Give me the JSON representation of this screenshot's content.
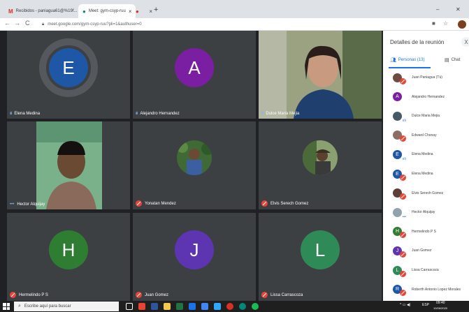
{
  "browser": {
    "tabs": [
      {
        "icon": "M",
        "title": "Recibidos - paniagua61@%19f..."
      },
      {
        "icon": "●",
        "title": "Meet: gym-csyp-ruu"
      },
      {
        "icon": "●",
        "title": ""
      }
    ],
    "new_tab": "+",
    "minimize": "–",
    "close": "✕",
    "back": "←",
    "forward": "→",
    "reload": "C",
    "url": "meet.google.com/gym-csyp-ruu?pli=1&authuser=0"
  },
  "tiles": [
    {
      "name": "Elena Medina",
      "initial": "E",
      "color": "#1e57a6",
      "status": "active"
    },
    {
      "name": "Alejandro Hernandez",
      "initial": "A",
      "color": "#7b1fa2",
      "status": "active"
    },
    {
      "name": "Dulce Maria Mejia",
      "initial": "",
      "color": "",
      "status": "active"
    },
    {
      "name": "Hector Alquijay",
      "initial": "",
      "color": "",
      "status": "dots"
    },
    {
      "name": "Yonatan Mendez",
      "initial": "",
      "color": "",
      "status": "muted"
    },
    {
      "name": "Elvis Serech Gomez",
      "initial": "",
      "color": "",
      "status": "muted"
    },
    {
      "name": "Hermelindo P S",
      "initial": "H",
      "color": "#2e7d32",
      "status": "muted"
    },
    {
      "name": "Juan Gomez",
      "initial": "J",
      "color": "#5e35b1",
      "status": "muted"
    },
    {
      "name": "Lissa Carrascoza",
      "initial": "L",
      "color": "#2e8b57",
      "status": "muted"
    }
  ],
  "panel": {
    "title": "Detalles de la reunión",
    "close": "X",
    "people_tab": "Personas (13)",
    "chat_tab": "Chat",
    "people": [
      {
        "name": "Juan Paniagua (Tú)",
        "initial": "",
        "color": "#6d4c41",
        "status": "muted"
      },
      {
        "name": "Alejandro Hernandez",
        "initial": "A",
        "color": "#7b1fa2",
        "status": "none"
      },
      {
        "name": "Dulce Maria Mejia",
        "initial": "",
        "color": "#455a64",
        "status": "active"
      },
      {
        "name": "Edward Chonay",
        "initial": "",
        "color": "#8d6e63",
        "status": "muted"
      },
      {
        "name": "Elena Medina",
        "initial": "E",
        "color": "#1e57a6",
        "status": "active"
      },
      {
        "name": "Elena Medina",
        "initial": "E",
        "color": "#1e57a6",
        "status": "muted"
      },
      {
        "name": "Elvis Serech Gomez",
        "initial": "",
        "color": "#5d4037",
        "status": "muted"
      },
      {
        "name": "Hector Alquijay",
        "initial": "",
        "color": "#90a4ae",
        "status": "dots"
      },
      {
        "name": "Hermelindo P S",
        "initial": "H",
        "color": "#2e7d32",
        "status": "muted"
      },
      {
        "name": "Juan Gomez",
        "initial": "J",
        "color": "#5e35b1",
        "status": "muted"
      },
      {
        "name": "Lissa Carrascoza",
        "initial": "L",
        "color": "#2e8b57",
        "status": "muted"
      },
      {
        "name": "Roberth Antonio Lopez Morales",
        "initial": "R",
        "color": "#1e57a6",
        "status": "muted"
      }
    ]
  },
  "taskbar": {
    "search_placeholder": "Escribe aquí para buscar",
    "tray_lang": "ESP",
    "time": "09:40",
    "date": "10/06/2020"
  }
}
